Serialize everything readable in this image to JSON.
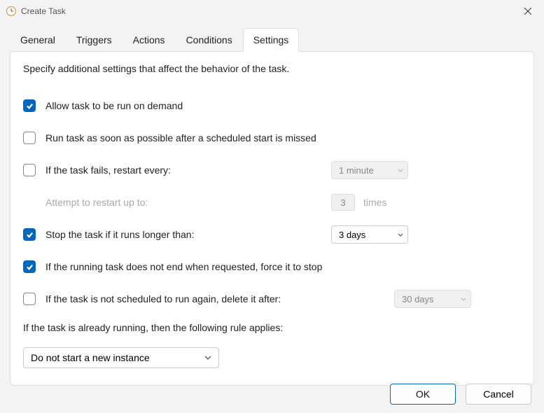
{
  "window": {
    "title": "Create Task"
  },
  "tabs": {
    "general": "General",
    "triggers": "Triggers",
    "actions": "Actions",
    "conditions": "Conditions",
    "settings": "Settings"
  },
  "settings": {
    "description": "Specify additional settings that affect the behavior of the task.",
    "allow_on_demand": "Allow task to be run on demand",
    "run_asap": "Run task as soon as possible after a scheduled start is missed",
    "restart_every": "If the task fails, restart every:",
    "restart_every_value": "1 minute",
    "attempt_label": "Attempt to restart up to:",
    "attempt_count": "3",
    "attempt_times": "times",
    "stop_longer": "Stop the task if it runs longer than:",
    "stop_longer_value": "3 days",
    "force_stop": "If the running task does not end when requested, force it to stop",
    "delete_after": "If the task is not scheduled to run again, delete it after:",
    "delete_after_value": "30 days",
    "rule_label": "If the task is already running, then the following rule applies:",
    "rule_value": "Do not start a new instance"
  },
  "buttons": {
    "ok": "OK",
    "cancel": "Cancel"
  }
}
